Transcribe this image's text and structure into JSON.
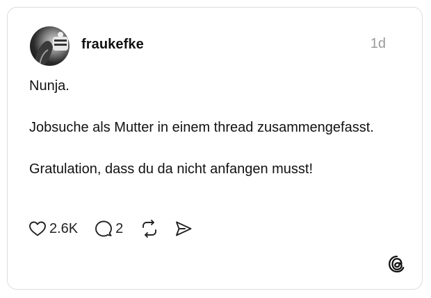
{
  "post": {
    "username": "fraukefke",
    "timestamp": "1d",
    "text_lines": [
      "Nunja.",
      "Jobsuche als Mutter in einem thread zusammengefasst.",
      "Gratulation, dass du da nicht anfangen musst!"
    ],
    "likes": "2.6K",
    "replies": "2"
  },
  "icons": {
    "like": "heart-icon",
    "reply": "comment-bubble-icon",
    "repost": "repost-arrows-icon",
    "share": "send-icon",
    "brand": "threads-logo-icon"
  }
}
